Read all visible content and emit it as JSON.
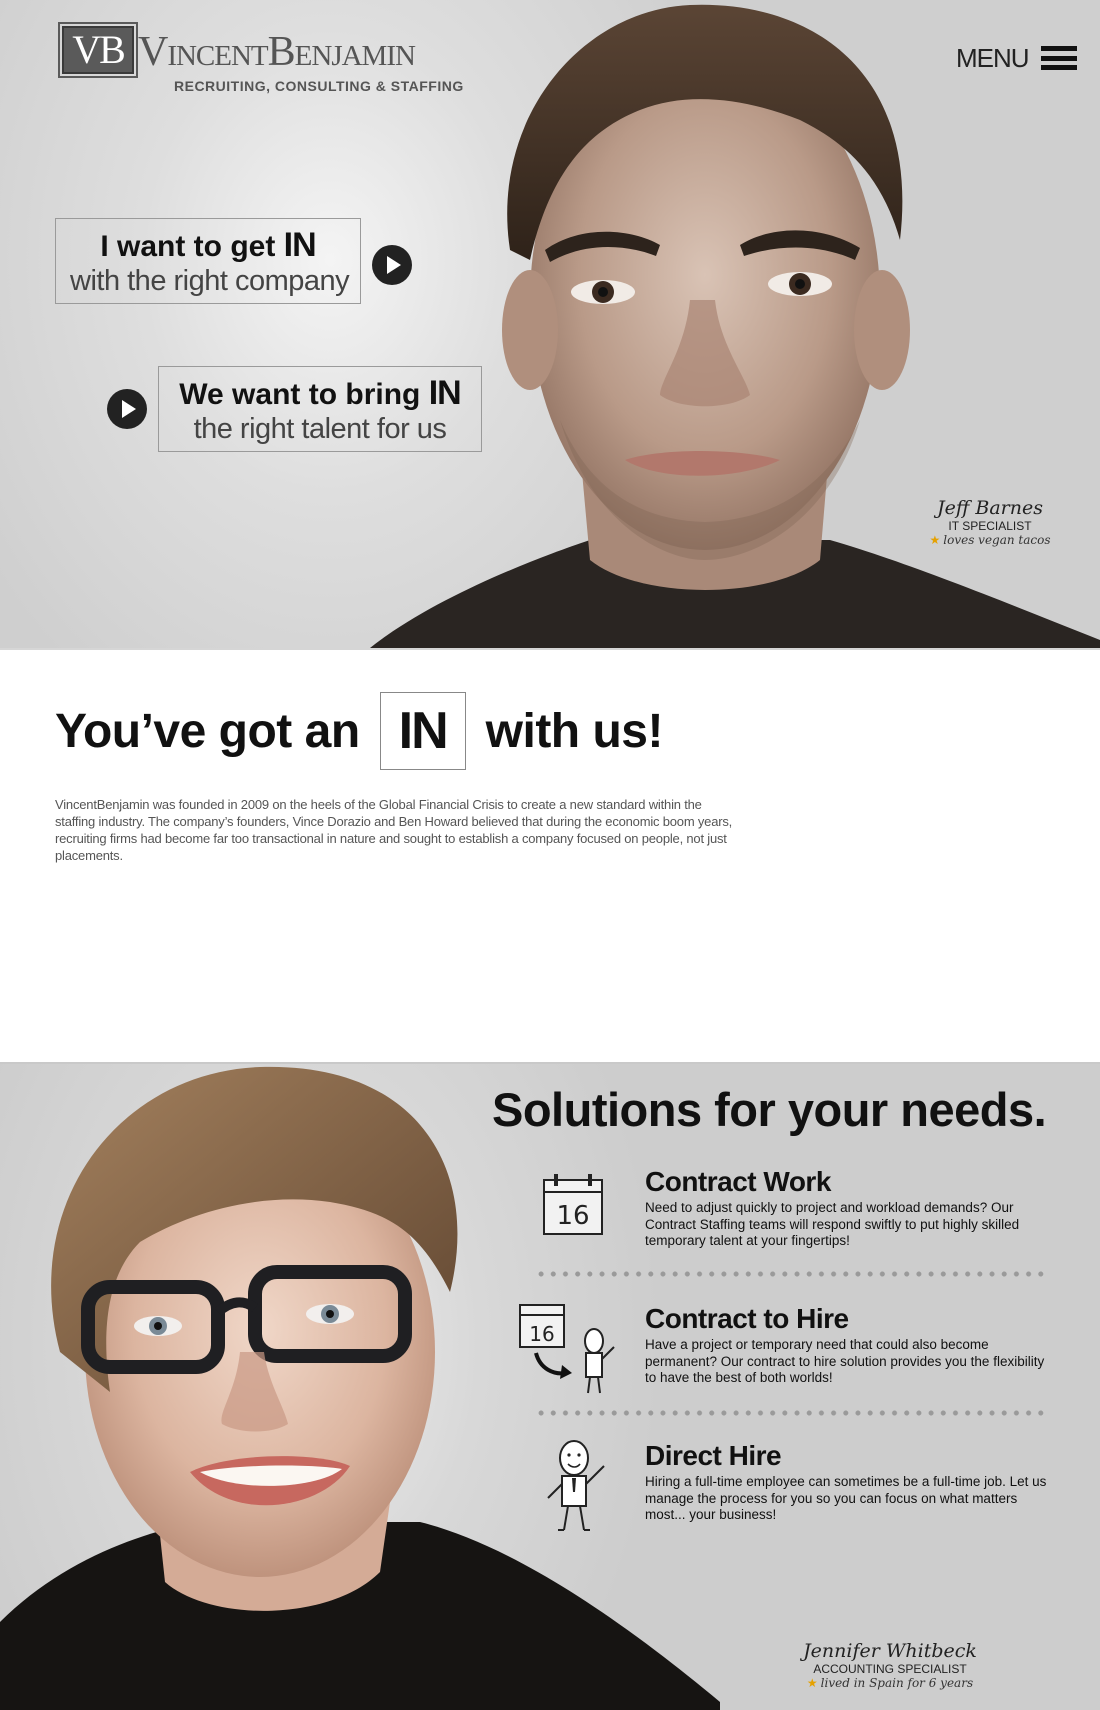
{
  "header": {
    "logo_mark": "VB",
    "logo_name": "VincentBenjamin",
    "logo_tagline": "RECRUITING, CONSULTING & STAFFING",
    "menu_label": "MENU"
  },
  "hero": {
    "cta_candidate": {
      "line1": "I want to get",
      "in": "IN",
      "line2": "with the right company"
    },
    "cta_employer": {
      "line1": "We want to bring",
      "in": "IN",
      "line2": "the right talent for us"
    },
    "caption": {
      "name": "Jeff Barnes",
      "role": "IT SPECIALIST",
      "fact": "loves vegan tacos"
    }
  },
  "about": {
    "heading_before": "You’ve got an",
    "heading_in": "IN",
    "heading_after": "with us!",
    "body": "VincentBenjamin was founded in 2009 on the heels of the Global Financial Crisis to create a new standard within the staffing industry. The company’s founders, Vince Dorazio and Ben Howard believed that during the economic boom years, recruiting firms had become far too transactional in nature and sought to establish a company focused on people, not just placements."
  },
  "solutions": {
    "title": "Solutions for your needs.",
    "items": [
      {
        "name": "Contract Work",
        "icon": "calendar-icon",
        "calendar_day": "16",
        "description": "Need to adjust quickly to project and workload demands? Our Contract Staffing teams will respond swiftly to put highly skilled temporary talent at your fingertips!"
      },
      {
        "name": "Contract to Hire",
        "icon": "calendar-to-person-icon",
        "calendar_day": "16",
        "description": "Have a project or temporary need that could also become permanent?  Our contract to hire solution provides you the flexibility to have the best of both worlds!"
      },
      {
        "name": "Direct Hire",
        "icon": "person-icon",
        "description": "Hiring a full-time employee can sometimes be a full-time job. Let us manage the process for you so you can focus on what matters most...  your business!"
      }
    ],
    "caption": {
      "name": "Jennifer Whitbeck",
      "role": "ACCOUNTING SPECIALIST",
      "fact": "lived in Spain for 6 years"
    }
  },
  "colors": {
    "accent_star": "#e5a100",
    "text_dark": "#111111",
    "panel_gray": "#cfcfcf"
  }
}
